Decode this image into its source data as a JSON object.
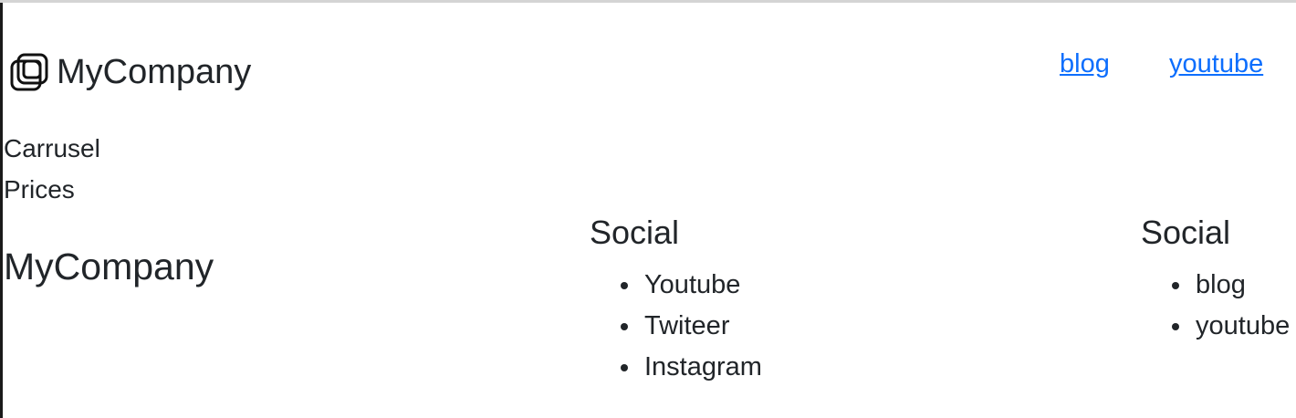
{
  "header": {
    "brand_name": "MyCompany",
    "brand_icon": "stacked-squares-logo-icon",
    "nav": [
      {
        "label": "blog"
      },
      {
        "label": "youtube"
      }
    ]
  },
  "sidebar": {
    "links": [
      {
        "label": "Carrusel"
      },
      {
        "label": "Prices"
      }
    ]
  },
  "footer": {
    "brand_name": "MyCompany",
    "columns": [
      {
        "heading": "Social",
        "items": [
          "Youtube",
          "Twiteer",
          "Instagram"
        ]
      },
      {
        "heading": "Social",
        "items": [
          "blog",
          "youtube"
        ]
      }
    ]
  },
  "colors": {
    "link": "#0d6efd",
    "text": "#212529",
    "background": "#ffffff"
  }
}
